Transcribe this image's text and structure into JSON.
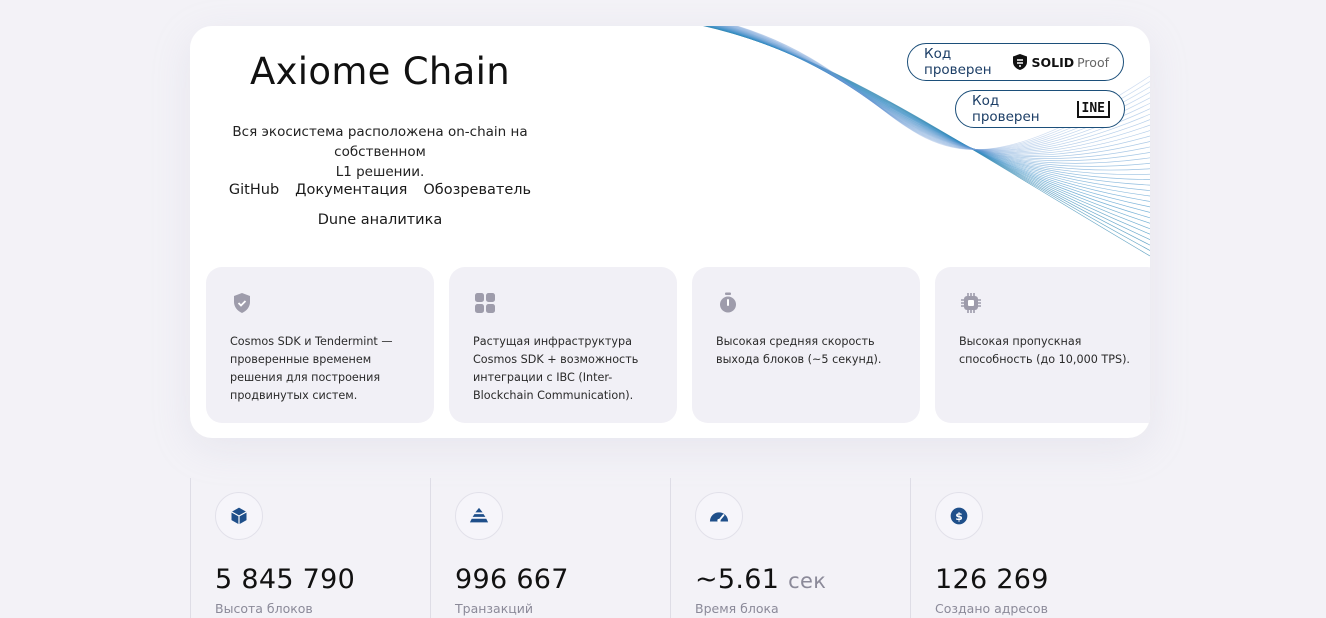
{
  "hero": {
    "title": "Axiome Chain",
    "subtitle_line1": "Вся экосистема расположена on-chain на собственном",
    "subtitle_line2": "L1 решении.",
    "links": [
      "GitHub",
      "Документация",
      "Обозреватель",
      "Dune аналитика"
    ],
    "badges": [
      {
        "label": "Код проверен",
        "logo": "SOLID",
        "logo_suffix": "Proof"
      },
      {
        "label": "Код проверен",
        "logo": "INE"
      }
    ]
  },
  "features": [
    {
      "icon": "shield-check-icon",
      "text": "Cosmos SDK и Tendermint — проверенные временем решения для построения продвинутых систем."
    },
    {
      "icon": "grid-icon",
      "text": "Растущая инфраструктура Cosmos SDK + возможность интеграции с IBC (Inter-Blockchain Communication)."
    },
    {
      "icon": "stopwatch-icon",
      "text": "Высокая средняя скорость выхода блоков (~5 секунд)."
    },
    {
      "icon": "chip-icon",
      "text": "Высокая пропускная способность (до 10,000 TPS)."
    }
  ],
  "stats": [
    {
      "icon": "cube-icon",
      "value": "5 845 790",
      "unit": "",
      "label": "Высота блоков"
    },
    {
      "icon": "layers-icon",
      "value": "996 667",
      "unit": "",
      "label": "Транзакций"
    },
    {
      "icon": "speedometer-icon",
      "value": "~5.61",
      "unit": "сек",
      "label": "Время блока"
    },
    {
      "icon": "dollar-icon",
      "value": "126 269",
      "unit": "",
      "label": "Создано адресов"
    }
  ],
  "colors": {
    "background": "#f3f2f7",
    "card": "#f1f0f6",
    "badge_border": "#1c4f7a",
    "stat_icon": "#1f4f8a"
  }
}
